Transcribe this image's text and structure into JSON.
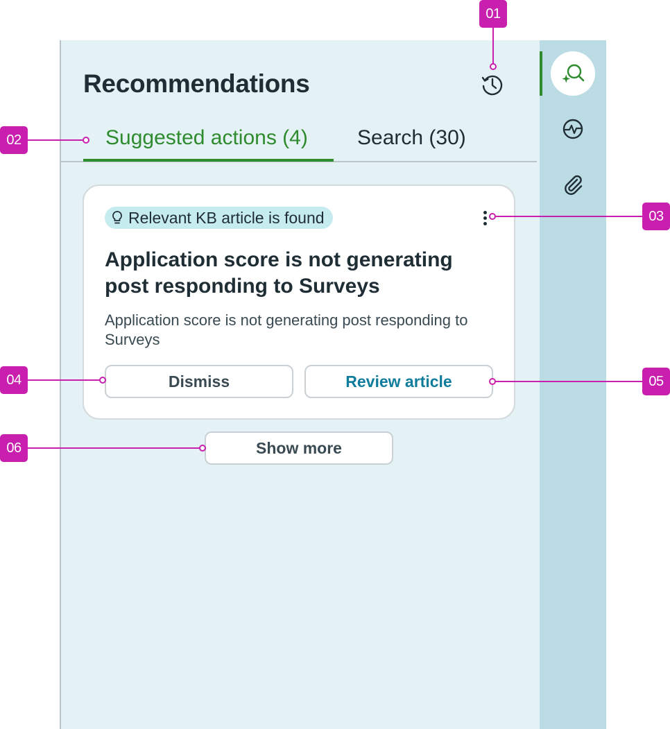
{
  "header": {
    "title": "Recommendations",
    "history_icon": "history-clock-icon"
  },
  "tabs": [
    {
      "label": "Suggested actions (4)",
      "active": true
    },
    {
      "label": "Search (30)",
      "active": false
    }
  ],
  "card": {
    "badge": {
      "icon": "lightbulb-icon",
      "label": "Relevant KB article is found"
    },
    "menu_icon": "more-vertical-icon",
    "title": "Application score is not generating post responding to Surveys",
    "description": "Application score is not generating post responding to Surveys",
    "dismiss_label": "Dismiss",
    "review_label": "Review article"
  },
  "show_more_label": "Show more",
  "rail": {
    "items": [
      {
        "icon": "sparkle-search-icon",
        "active": true
      },
      {
        "icon": "activity-icon",
        "active": false
      },
      {
        "icon": "paperclip-icon",
        "active": false
      }
    ]
  },
  "annotations": [
    "01",
    "02",
    "03",
    "04",
    "05",
    "06"
  ],
  "colors": {
    "accent_green": "#2e8b2e",
    "link_teal": "#0f7c9b",
    "panel_bg": "#e4f1f5",
    "rail_bg": "#bbdce5",
    "badge_bg": "#c6ecef",
    "annotation_magenta": "#c81fae"
  }
}
